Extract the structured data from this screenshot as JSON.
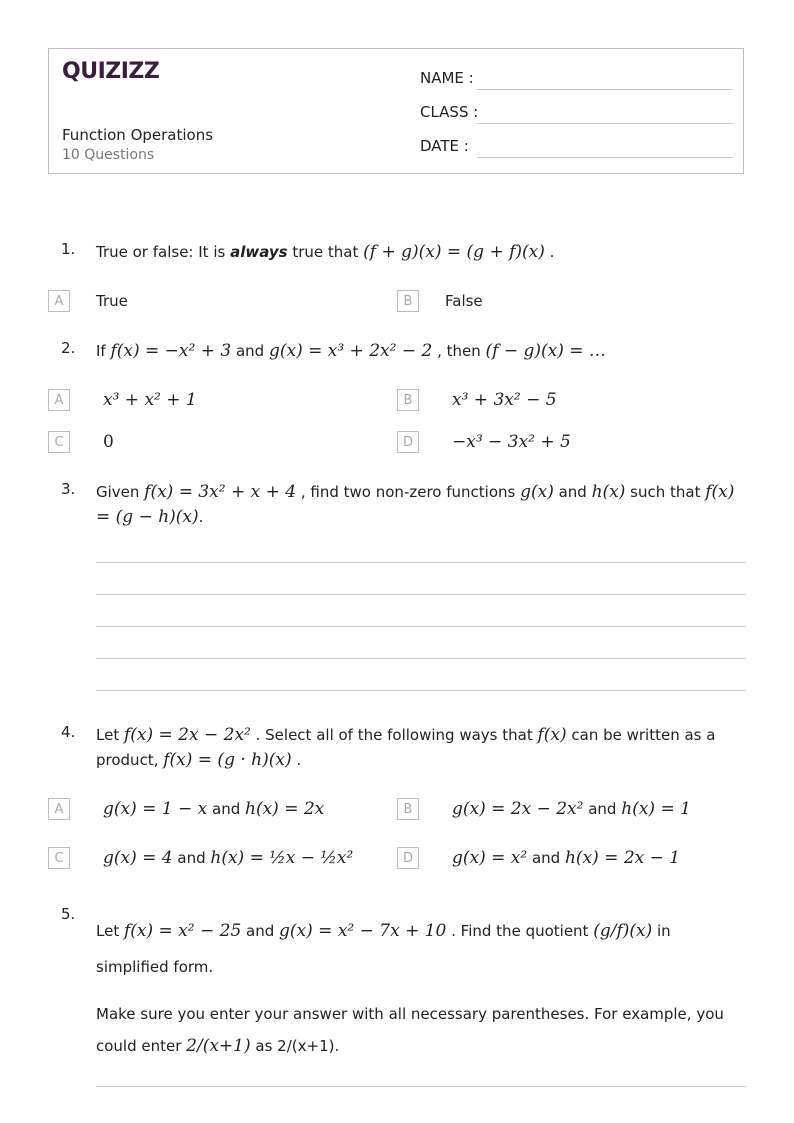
{
  "header": {
    "logo": "QUIZIZZ",
    "title": "Function Operations",
    "subtitle": "10 Questions",
    "fields": [
      {
        "label": "NAME :"
      },
      {
        "label": "CLASS :"
      },
      {
        "label": "DATE  :"
      }
    ],
    "brand_color": "#3b1d3d"
  },
  "questions": [
    {
      "number": "1.",
      "text_pre": "True or false: It is ",
      "text_bold": "always",
      "text_mid": " true that ",
      "math": "(f + g)(x) = (g + f)(x)",
      "text_post": " .",
      "options": [
        {
          "letter": "A",
          "text": "True"
        },
        {
          "letter": "B",
          "text": "False"
        }
      ]
    },
    {
      "number": "2.",
      "text_a": "If ",
      "math_a": "f(x) = −x² + 3",
      "text_b": " and ",
      "math_b": "g(x) = x³ + 2x² − 2",
      "text_c": " , then ",
      "math_c": "(f − g)(x) = …",
      "options": [
        {
          "letter": "A",
          "text": "x³ + x² + 1"
        },
        {
          "letter": "B",
          "text": "x³ + 3x² − 5"
        },
        {
          "letter": "C",
          "text": "0"
        },
        {
          "letter": "D",
          "text": "−x³ − 3x² + 5"
        }
      ]
    },
    {
      "number": "3.",
      "text_a": "Given ",
      "math_a": "f(x) = 3x² + x + 4",
      "text_b": " , find two non-zero functions ",
      "math_b": "g(x)",
      "text_c": " and ",
      "math_c": "h(x)",
      "text_d": " such that ",
      "math_d": "f(x) = (g − h)(x)",
      "text_e": "."
    },
    {
      "number": "4.",
      "text_a": "Let ",
      "math_a": "f(x) = 2x − 2x²",
      "text_b": " . Select all of the following ways that ",
      "math_b": "f(x)",
      "text_c": " can be written as a product, ",
      "math_c": "f(x) = (g · h)(x)",
      "text_d": " .",
      "options": [
        {
          "letter": "A",
          "g": "g(x) = 1 − x",
          "and": " and ",
          "h": "h(x) = 2x"
        },
        {
          "letter": "B",
          "g": "g(x) = 2x − 2x²",
          "and": " and ",
          "h": "h(x) = 1"
        },
        {
          "letter": "C",
          "g": "g(x) = 4",
          "and": " and ",
          "h": "h(x) = ½x − ½x²"
        },
        {
          "letter": "D",
          "g": "g(x) = x²",
          "and": " and ",
          "h": "h(x) = 2x − 1"
        }
      ]
    },
    {
      "number": "5.",
      "text_a": "Let ",
      "math_a": "f(x) = x² − 25",
      "text_b": " and ",
      "math_b": "g(x) = x² − 7x + 10",
      "text_c": " . Find the quotient ",
      "math_c": "(g/f)(x)",
      "text_d": " in simplified form.",
      "note_a": "Make sure you enter your answer with all necessary parentheses. For example, you could enter ",
      "note_frac": "2/(x+1)",
      "note_b": " as 2/(x+1)."
    }
  ]
}
